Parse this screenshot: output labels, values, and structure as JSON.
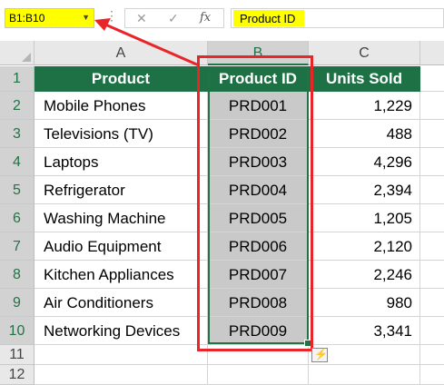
{
  "formula_bar": {
    "name_box": "B1:B10",
    "dropdown_glyph": "▼",
    "more_glyph": "⋮",
    "cancel_glyph": "✕",
    "enter_glyph": "✓",
    "fx_label": "fx",
    "value": "Product ID"
  },
  "columns": [
    "A",
    "B",
    "C"
  ],
  "rows": [
    "1",
    "2",
    "3",
    "4",
    "5",
    "6",
    "7",
    "8",
    "9",
    "10",
    "11",
    "12"
  ],
  "table": {
    "headers": [
      "Product",
      "Product ID",
      "Units Sold"
    ],
    "rows": [
      [
        "Mobile Phones",
        "PRD001",
        "1,229"
      ],
      [
        "Televisions (TV)",
        "PRD002",
        "488"
      ],
      [
        "Laptops",
        "PRD003",
        "4,296"
      ],
      [
        "Refrigerator",
        "PRD004",
        "2,394"
      ],
      [
        "Washing Machine",
        "PRD005",
        "1,205"
      ],
      [
        "Audio Equipment",
        "PRD006",
        "2,120"
      ],
      [
        "Kitchen Appliances",
        "PRD007",
        "2,246"
      ],
      [
        "Air Conditioners",
        "PRD008",
        "980"
      ],
      [
        "Networking Devices",
        "PRD009",
        "3,341"
      ]
    ]
  },
  "selection": {
    "range": "B1:B10",
    "column": "B"
  },
  "colors": {
    "header_green": "#1e7145",
    "selected_fill": "#c9c9c9",
    "highlight": "#ffff00",
    "annotation_red": "#e8262a"
  },
  "icons": {
    "quick_analysis": "quick-analysis-icon",
    "quick_analysis_glyph": "⚡"
  }
}
